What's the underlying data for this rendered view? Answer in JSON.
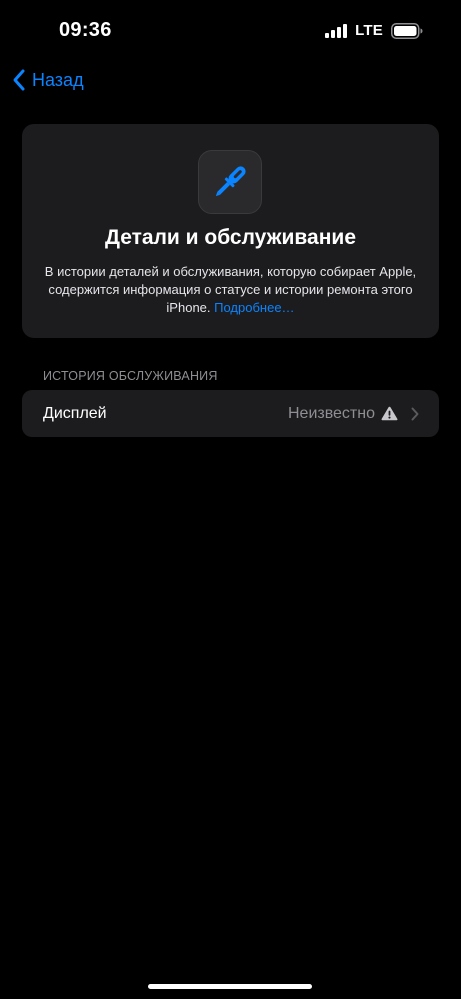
{
  "status_bar": {
    "time": "09:36",
    "network": "LTE",
    "icons": [
      "signal-bars-icon",
      "battery-icon"
    ]
  },
  "nav": {
    "back_label": "Назад",
    "back_icon": "chevron-left-icon"
  },
  "hero": {
    "icon": "screwdriver-icon",
    "title": "Детали и обслуживание",
    "description": "В истории деталей и обслуживания, которую собирает Apple, содержится информация о статусе и истории ремонта этого iPhone.",
    "link": "Подробнее…"
  },
  "service_history": {
    "header": "ИСТОРИЯ ОБСЛУЖИВАНИЯ",
    "rows": [
      {
        "label": "Дисплей",
        "value": "Неизвестно",
        "status_icon": "warning-triangle-icon",
        "accessory_icon": "chevron-right-icon"
      }
    ]
  },
  "colors": {
    "background": "#000000",
    "card": "#1c1c1e",
    "accent": "#0A84FF",
    "secondary_text": "#8e8e93"
  }
}
